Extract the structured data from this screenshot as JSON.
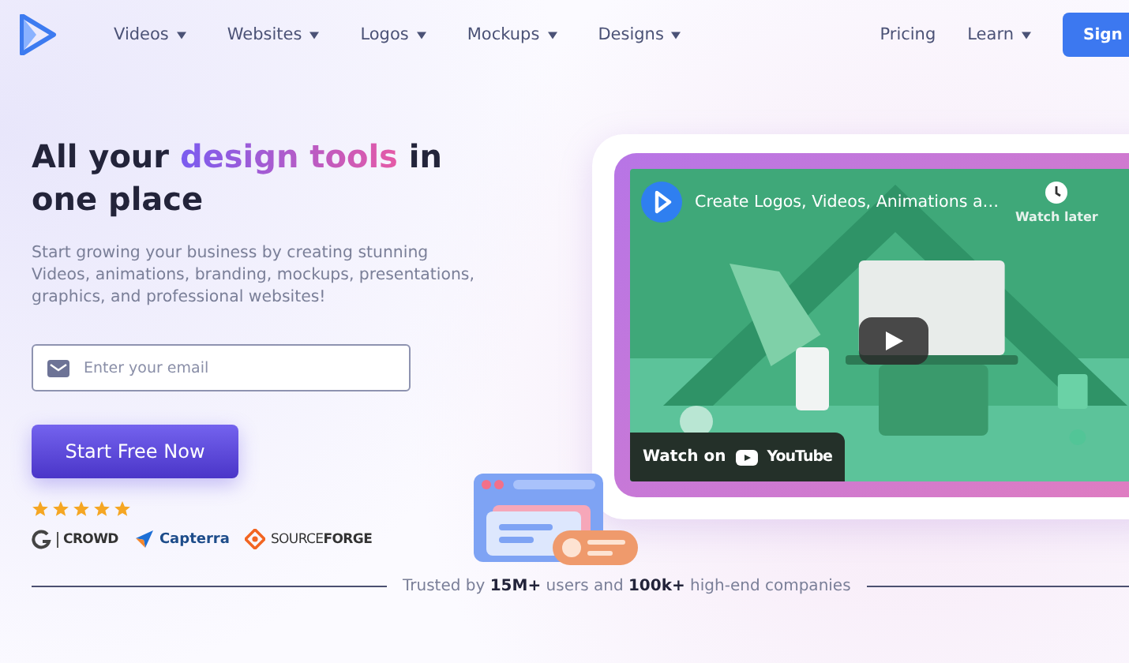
{
  "nav": {
    "items": [
      {
        "label": "Videos",
        "dropdown": true
      },
      {
        "label": "Websites",
        "dropdown": true
      },
      {
        "label": "Logos",
        "dropdown": true
      },
      {
        "label": "Mockups",
        "dropdown": true
      },
      {
        "label": "Designs",
        "dropdown": true
      }
    ],
    "right_links": [
      {
        "label": "Pricing",
        "dropdown": false
      },
      {
        "label": "Learn",
        "dropdown": true
      }
    ],
    "cta": "Sign"
  },
  "hero": {
    "title_parts": [
      {
        "text": "All your ",
        "highlight": false
      },
      {
        "text": "design tools",
        "highlight": true
      },
      {
        "text": " in one place",
        "highlight": false
      }
    ],
    "description": "Start growing your business by creating stunning Videos, animations, branding, mockups, presentations, graphics, and professional websites!",
    "email": {
      "placeholder": "Enter your email"
    },
    "cta": "Start Free Now",
    "rating": {
      "stars": 5
    },
    "review_sites": [
      {
        "kind": "g2",
        "label": "CROWD"
      },
      {
        "kind": "capterra",
        "label": "Capterra"
      },
      {
        "kind": "sourceforge",
        "label": "SOURCE**FORGE**"
      }
    ]
  },
  "video": {
    "title": "Create Logos, Videos, Animations a…",
    "watch_later": "Watch later",
    "watch_on": "Watch on",
    "brand": "YouTube"
  },
  "trusted": "Trusted by **15M+** users and **100k+** high-end companies"
}
